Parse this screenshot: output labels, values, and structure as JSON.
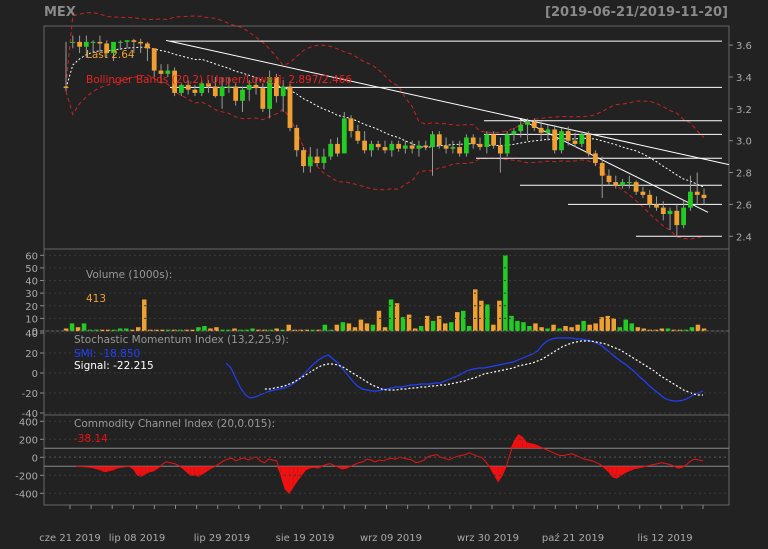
{
  "header": {
    "symbol": "MEX",
    "date_range": "[2019-06-21/2019-11-20]"
  },
  "chart_data": [
    {
      "type": "candlestick",
      "name": "price",
      "ylim": [
        2.32,
        3.72
      ],
      "y_ticks": [
        "2.4",
        "2.6",
        "2.8",
        "3.0",
        "3.2",
        "3.4",
        "3.6"
      ],
      "last_label": "Last 2.64",
      "bollinger_label": "Bollinger Bands (20,2) [Upper/Lower]: 2.897/2.466",
      "colors": {
        "up": "#22cc22",
        "down": "#f0a030",
        "bands": "#cc2222",
        "ma": "#ffffff"
      },
      "candles": [
        [
          3.34,
          3.62,
          3.31,
          3.33
        ],
        [
          3.62,
          3.66,
          3.58,
          3.62
        ],
        [
          3.62,
          3.66,
          3.55,
          3.59
        ],
        [
          3.59,
          3.66,
          3.52,
          3.62
        ],
        [
          3.62,
          3.63,
          3.55,
          3.62
        ],
        [
          3.62,
          3.66,
          3.56,
          3.61
        ],
        [
          3.61,
          3.63,
          3.52,
          3.55
        ],
        [
          3.55,
          3.62,
          3.5,
          3.62
        ],
        [
          3.62,
          3.63,
          3.57,
          3.62
        ],
        [
          3.62,
          3.63,
          3.58,
          3.63
        ],
        [
          3.63,
          3.64,
          3.55,
          3.62
        ],
        [
          3.62,
          3.64,
          3.55,
          3.61
        ],
        [
          3.61,
          3.62,
          3.5,
          3.58
        ],
        [
          3.58,
          3.58,
          3.4,
          3.44
        ],
        [
          3.44,
          3.48,
          3.36,
          3.42
        ],
        [
          3.42,
          3.48,
          3.4,
          3.44
        ],
        [
          3.44,
          3.46,
          3.28,
          3.3
        ],
        [
          3.3,
          3.36,
          3.28,
          3.35
        ],
        [
          3.35,
          3.38,
          3.29,
          3.32
        ],
        [
          3.32,
          3.35,
          3.28,
          3.3
        ],
        [
          3.3,
          3.38,
          3.28,
          3.36
        ],
        [
          3.36,
          3.38,
          3.3,
          3.34
        ],
        [
          3.34,
          3.4,
          3.27,
          3.28
        ],
        [
          3.28,
          3.4,
          3.2,
          3.34
        ],
        [
          3.34,
          3.4,
          3.3,
          3.34
        ],
        [
          3.34,
          3.36,
          3.22,
          3.25
        ],
        [
          3.25,
          3.34,
          3.18,
          3.32
        ],
        [
          3.32,
          3.38,
          3.25,
          3.35
        ],
        [
          3.35,
          3.4,
          3.29,
          3.33
        ],
        [
          3.33,
          3.36,
          3.18,
          3.2
        ],
        [
          3.2,
          3.44,
          3.14,
          3.4
        ],
        [
          3.4,
          3.42,
          3.24,
          3.28
        ],
        [
          3.28,
          3.38,
          3.18,
          3.34
        ],
        [
          3.34,
          3.36,
          3.06,
          3.08
        ],
        [
          3.08,
          3.1,
          2.9,
          2.94
        ],
        [
          2.94,
          2.96,
          2.8,
          2.84
        ],
        [
          2.84,
          2.96,
          2.8,
          2.9
        ],
        [
          2.9,
          2.95,
          2.84,
          2.86
        ],
        [
          2.86,
          2.95,
          2.82,
          2.9
        ],
        [
          2.9,
          3.01,
          2.88,
          2.98
        ],
        [
          2.98,
          3.02,
          2.9,
          2.92
        ],
        [
          2.92,
          3.18,
          2.92,
          3.14
        ],
        [
          3.14,
          3.16,
          3.02,
          3.06
        ],
        [
          3.06,
          3.1,
          2.98,
          3.0
        ],
        [
          3.0,
          3.06,
          2.92,
          2.94
        ],
        [
          2.94,
          3.0,
          2.9,
          2.98
        ],
        [
          2.98,
          3.0,
          2.94,
          2.96
        ],
        [
          2.96,
          3.0,
          2.92,
          2.94
        ],
        [
          2.94,
          3.0,
          2.9,
          2.98
        ],
        [
          2.98,
          3.0,
          2.93,
          2.95
        ],
        [
          2.95,
          3.0,
          2.92,
          2.97
        ],
        [
          2.97,
          3.0,
          2.92,
          2.95
        ],
        [
          2.95,
          3.0,
          2.9,
          2.97
        ],
        [
          2.97,
          3.0,
          2.94,
          2.96
        ],
        [
          2.96,
          3.06,
          2.78,
          3.04
        ],
        [
          3.04,
          3.06,
          2.95,
          2.97
        ],
        [
          2.97,
          3.02,
          2.92,
          2.95
        ],
        [
          2.95,
          3.0,
          2.92,
          2.96
        ],
        [
          2.96,
          3.0,
          2.9,
          2.92
        ],
        [
          2.92,
          3.04,
          2.9,
          3.02
        ],
        [
          3.02,
          3.04,
          2.95,
          2.98
        ],
        [
          2.98,
          3.02,
          2.94,
          2.96
        ],
        [
          2.96,
          3.06,
          2.92,
          3.04
        ],
        [
          3.04,
          3.06,
          2.95,
          2.97
        ],
        [
          2.97,
          3.02,
          2.8,
          2.92
        ],
        [
          2.92,
          3.06,
          2.9,
          3.04
        ],
        [
          3.04,
          3.08,
          3.0,
          3.06
        ],
        [
          3.06,
          3.12,
          3.02,
          3.1
        ],
        [
          3.1,
          3.14,
          3.0,
          3.12
        ],
        [
          3.12,
          3.14,
          3.06,
          3.08
        ],
        [
          3.08,
          3.12,
          3.0,
          3.05
        ],
        [
          3.05,
          3.1,
          3.0,
          3.07
        ],
        [
          3.07,
          3.1,
          2.92,
          2.94
        ],
        [
          2.94,
          3.08,
          2.92,
          3.06
        ],
        [
          3.06,
          3.09,
          2.97,
          3.0
        ],
        [
          3.0,
          3.05,
          2.96,
          2.98
        ],
        [
          2.98,
          3.06,
          2.96,
          3.04
        ],
        [
          3.04,
          3.06,
          2.9,
          2.92
        ],
        [
          2.92,
          2.94,
          2.84,
          2.86
        ],
        [
          2.86,
          2.9,
          2.64,
          2.78
        ],
        [
          2.78,
          2.82,
          2.72,
          2.74
        ],
        [
          2.74,
          2.78,
          2.7,
          2.72
        ],
        [
          2.72,
          2.76,
          2.7,
          2.74
        ],
        [
          2.74,
          2.78,
          2.7,
          2.74
        ],
        [
          2.74,
          2.75,
          2.66,
          2.68
        ],
        [
          2.68,
          2.71,
          2.64,
          2.66
        ],
        [
          2.66,
          2.69,
          2.58,
          2.6
        ],
        [
          2.6,
          2.65,
          2.56,
          2.58
        ],
        [
          2.58,
          2.62,
          2.5,
          2.54
        ],
        [
          2.54,
          2.58,
          2.44,
          2.56
        ],
        [
          2.56,
          2.6,
          2.4,
          2.47
        ],
        [
          2.47,
          2.62,
          2.45,
          2.58
        ],
        [
          2.58,
          2.78,
          2.56,
          2.68
        ],
        [
          2.68,
          2.8,
          2.6,
          2.66
        ],
        [
          2.66,
          2.7,
          2.6,
          2.64
        ]
      ]
    },
    {
      "type": "bar",
      "name": "volume",
      "ylim": [
        0,
        65
      ],
      "y_ticks": [
        "0",
        "10",
        "20",
        "30",
        "40",
        "50",
        "60"
      ],
      "label": "Volume (1000s):",
      "value_label": "413",
      "values": [
        2,
        6,
        3,
        6,
        1,
        1,
        1,
        1,
        1,
        2,
        2,
        1,
        3,
        25,
        1,
        1,
        1,
        1,
        1,
        1,
        1,
        1,
        3,
        4,
        2,
        3,
        1,
        1,
        2,
        1,
        1,
        2,
        1,
        1,
        1,
        2,
        1,
        5,
        1,
        1,
        1,
        1,
        1,
        5,
        1,
        5,
        7,
        6,
        3,
        9,
        6,
        5,
        16,
        3,
        25,
        22,
        11,
        13,
        2,
        4,
        12,
        8,
        12,
        6,
        7,
        15,
        16,
        4,
        33,
        24,
        21,
        5,
        24,
        60,
        12,
        8,
        7,
        4,
        6,
        3,
        2,
        5,
        2,
        4,
        3,
        5,
        8,
        5,
        6,
        11,
        12,
        10,
        3,
        9,
        6,
        3,
        2,
        1,
        1,
        2,
        2,
        1,
        1,
        1,
        3,
        5,
        2
      ]
    },
    {
      "type": "line",
      "name": "stochastic",
      "ylim": [
        -42,
        42
      ],
      "y_ticks": [
        "-40",
        "-20",
        "0",
        "20",
        "40"
      ],
      "label": "Stochastic Momentum Index (13,2,25,9):",
      "smi_label": "SMI: -18.850",
      "signal_label": "Signal: -22.215",
      "series": [
        {
          "name": "SMI",
          "color": "#2040ff",
          "values": [
            10,
            5,
            -5,
            -15,
            -22,
            -25,
            -24,
            -22,
            -20,
            -18,
            -17,
            -16,
            -15,
            -13,
            -10,
            -6,
            -1,
            4,
            9,
            13,
            16,
            18,
            14,
            10,
            4,
            -2,
            -8,
            -13,
            -16,
            -17,
            -18,
            -18,
            -17,
            -16,
            -15,
            -14,
            -14,
            -13,
            -12,
            -12,
            -11,
            -11,
            -11,
            -10,
            -10,
            -8,
            -6,
            -4,
            -2,
            1,
            3,
            4,
            5,
            5,
            6,
            7,
            8,
            9,
            10,
            11,
            13,
            15,
            17,
            19,
            22,
            28,
            32,
            34,
            35,
            35,
            35,
            35,
            34,
            34,
            33,
            32,
            30,
            28,
            24,
            20,
            16,
            12,
            9,
            5,
            1,
            -4,
            -8,
            -13,
            -17,
            -21,
            -25,
            -27,
            -28,
            -28,
            -27,
            -25,
            -22,
            -20,
            -18
          ]
        },
        {
          "name": "Signal",
          "color": "#ffffff",
          "values": [
            null,
            null,
            null,
            null,
            null,
            null,
            null,
            null,
            -16,
            -16,
            -15,
            -14,
            -13,
            -11,
            -9,
            -6,
            -3,
            0,
            3,
            6,
            8,
            9,
            9,
            8,
            6,
            3,
            0,
            -3,
            -6,
            -9,
            -12,
            -14,
            -16,
            -17,
            -17,
            -17,
            -16,
            -16,
            -15,
            -15,
            -14,
            -14,
            -13,
            -13,
            -12,
            -12,
            -11,
            -10,
            -9,
            -8,
            -6,
            -5,
            -3,
            -1,
            0,
            1,
            2,
            3,
            4,
            5,
            7,
            8,
            9,
            10,
            12,
            14,
            17,
            20,
            23,
            26,
            28,
            30,
            31,
            32,
            32,
            32,
            31,
            30,
            29,
            27,
            25,
            23,
            20,
            17,
            14,
            11,
            8,
            5,
            2,
            -2,
            -5,
            -8,
            -11,
            -14,
            -17,
            -19,
            -21,
            -22,
            -22
          ]
        }
      ]
    },
    {
      "type": "area",
      "name": "cci",
      "ylim": [
        -530,
        470
      ],
      "y_ticks": [
        "-400",
        "-200",
        "0",
        "200",
        "400"
      ],
      "label": "Commodity Channel Index (20,0.015):",
      "value_label": "-38.14",
      "color": "#ee1111",
      "values": [
        -100,
        -102,
        -104,
        -108,
        -115,
        -125,
        -140,
        -160,
        -150,
        -140,
        -120,
        -110,
        -105,
        -100,
        -130,
        -200,
        -210,
        -180,
        -160,
        -150,
        -120,
        -80,
        -50,
        -60,
        -70,
        -90,
        -120,
        -160,
        -200,
        -200,
        -210,
        -180,
        -150,
        -120,
        -100,
        -70,
        -40,
        -20,
        -10,
        -40,
        -20,
        -5,
        -30,
        -10,
        5,
        -40,
        -60,
        -20,
        -30,
        -40,
        -200,
        -350,
        -400,
        -330,
        -260,
        -200,
        -140,
        -120,
        -110,
        -120,
        -100,
        -80,
        -70,
        -90,
        -110,
        -130,
        -120,
        -100,
        -80,
        -60,
        -50,
        -20,
        -30,
        -50,
        -30,
        -40,
        -20,
        -10,
        -20,
        0,
        -10,
        -20,
        -30,
        -60,
        -50,
        -30,
        10,
        20,
        30,
        0,
        -10,
        -30,
        -5,
        10,
        20,
        30,
        50,
        30,
        10,
        0,
        -50,
        -110,
        -190,
        -270,
        -200,
        -100,
        50,
        190,
        250,
        220,
        160,
        150,
        140,
        120,
        100,
        80,
        60,
        40,
        20,
        20,
        30,
        40,
        20,
        0,
        -20,
        -30,
        -40,
        -60,
        -80,
        -120,
        -160,
        -220,
        -230,
        -200,
        -170,
        -150,
        -130,
        -120,
        -110,
        -100,
        -90,
        -80,
        -70,
        -60,
        -70,
        -80,
        -100,
        -120,
        -110,
        -80,
        -40,
        -20,
        -30,
        -38
      ]
    }
  ],
  "x_axis": {
    "labels": [
      "cze 21 2019",
      "lip 08 2019",
      "lip 29 2019",
      "sie 19 2019",
      "wrz 09 2019",
      "wrz 30 2019",
      "paź 21 2019",
      "lis 12 2019"
    ]
  }
}
